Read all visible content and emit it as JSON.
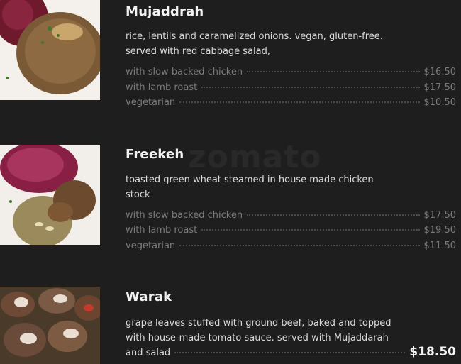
{
  "watermark": "zomato",
  "items": [
    {
      "title": "Mujaddrah",
      "desc": "rice, lentils and caramelized onions. vegan, gluten-free. served with red cabbage salad,",
      "options": [
        {
          "label": "with slow backed chicken",
          "price": "$16.50"
        },
        {
          "label": "with lamb roast",
          "price": "$17.50"
        },
        {
          "label": "vegetarian",
          "price": "$10.50"
        }
      ]
    },
    {
      "title": "Freekeh",
      "desc": "toasted green wheat steamed in house made chicken stock",
      "options": [
        {
          "label": "with slow backed chicken",
          "price": "$17.50"
        },
        {
          "label": "with lamb roast",
          "price": "$19.50"
        },
        {
          "label": "vegetarian",
          "price": "$11.50"
        }
      ]
    },
    {
      "title": "Warak",
      "desc_lines": [
        "grape leaves stuffed with ground beef, baked and topped",
        "with house-made tomato sauce. served with Mujaddarah"
      ],
      "desc_last": "and salad",
      "price": "$18.50"
    }
  ]
}
